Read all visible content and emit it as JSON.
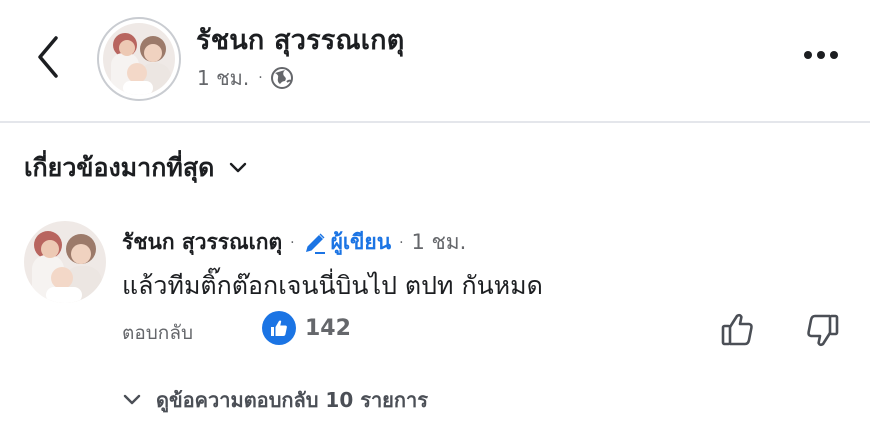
{
  "post": {
    "author": "รัชนก สุวรรณเกตุ",
    "time": "1 ชม.",
    "dot": "·"
  },
  "sort": {
    "label": "เกี่ยวข้องมากที่สุด"
  },
  "comment": {
    "author": "รัชนก สุวรรณเกตุ",
    "separator": "·",
    "badge_label": "ผู้เขียน",
    "time": "1 ชม.",
    "text": "แล้วทีมติ๊กต๊อกเจนนี่บินไป ตปท กันหมด",
    "reply_label": "ตอบกลับ",
    "like_count": "142",
    "view_replies_label": "ดูข้อความตอบกลับ 10 รายการ"
  },
  "icons": {
    "back": "chevron-left-icon",
    "privacy": "globe-icon",
    "more": "more-horizontal-icon",
    "sort": "chevron-down-icon",
    "author_badge": "pencil-icon",
    "like_reaction": "thumbs-up-icon",
    "like_button": "thumbs-up-outline-icon",
    "dislike_button": "thumbs-down-outline-icon",
    "replies": "chevron-down-icon"
  },
  "colors": {
    "accent": "#1b74e4",
    "text": "#1c1e21",
    "muted": "#65676b",
    "divider": "#e4e6eb"
  }
}
